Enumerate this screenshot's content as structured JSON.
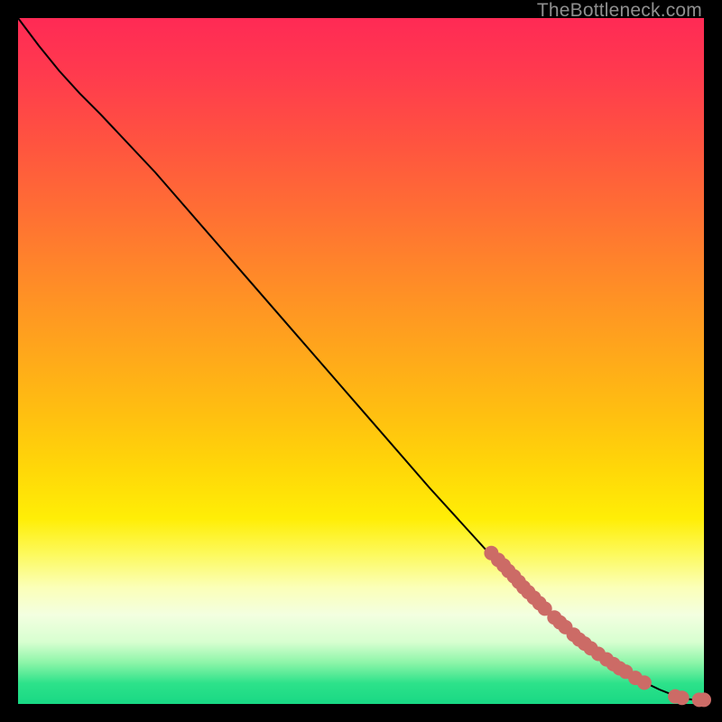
{
  "watermark": "TheBottleneck.com",
  "colors": {
    "dot": "#cc6b66",
    "curve": "#000000"
  },
  "chart_data": {
    "type": "line",
    "title": "",
    "xlabel": "",
    "ylabel": "",
    "xlim": [
      0,
      100
    ],
    "ylim": [
      0,
      100
    ],
    "grid": false,
    "legend": null,
    "background_gradient": {
      "direction": "vertical",
      "stops": [
        {
          "pos": 0.0,
          "color": "#ff2a55"
        },
        {
          "pos": 0.5,
          "color": "#ffc010"
        },
        {
          "pos": 0.75,
          "color": "#fdf95a"
        },
        {
          "pos": 0.9,
          "color": "#d7ffd0"
        },
        {
          "pos": 1.0,
          "color": "#18d884"
        }
      ]
    },
    "series": [
      {
        "name": "curve",
        "kind": "line",
        "x": [
          0,
          3,
          6,
          9,
          12,
          20,
          30,
          40,
          50,
          60,
          70,
          75,
          80,
          84,
          88,
          91,
          93.5,
          95.5,
          97,
          98.5,
          100
        ],
        "y": [
          100,
          96,
          92.3,
          89,
          86,
          77.5,
          66,
          54.5,
          43,
          31.5,
          20.5,
          15.5,
          11,
          8,
          5.3,
          3.3,
          2.1,
          1.3,
          0.8,
          0.6,
          0.6
        ]
      },
      {
        "name": "dots",
        "kind": "scatter",
        "points": [
          {
            "x": 69.0,
            "y": 22.0
          },
          {
            "x": 70.0,
            "y": 21.0
          },
          {
            "x": 70.8,
            "y": 20.2
          },
          {
            "x": 71.5,
            "y": 19.4
          },
          {
            "x": 72.3,
            "y": 18.6
          },
          {
            "x": 73.0,
            "y": 17.8
          },
          {
            "x": 73.7,
            "y": 17.0
          },
          {
            "x": 74.4,
            "y": 16.3
          },
          {
            "x": 75.2,
            "y": 15.5
          },
          {
            "x": 76.0,
            "y": 14.7
          },
          {
            "x": 76.8,
            "y": 13.9
          },
          {
            "x": 78.2,
            "y": 12.6
          },
          {
            "x": 79.0,
            "y": 11.9
          },
          {
            "x": 79.8,
            "y": 11.2
          },
          {
            "x": 81.0,
            "y": 10.1
          },
          {
            "x": 81.8,
            "y": 9.4
          },
          {
            "x": 82.6,
            "y": 8.8
          },
          {
            "x": 83.5,
            "y": 8.1
          },
          {
            "x": 84.6,
            "y": 7.3
          },
          {
            "x": 85.8,
            "y": 6.5
          },
          {
            "x": 86.8,
            "y": 5.8
          },
          {
            "x": 87.7,
            "y": 5.2
          },
          {
            "x": 88.6,
            "y": 4.7
          },
          {
            "x": 90.0,
            "y": 3.8
          },
          {
            "x": 91.3,
            "y": 3.1
          },
          {
            "x": 95.8,
            "y": 1.1
          },
          {
            "x": 96.8,
            "y": 0.9
          },
          {
            "x": 99.3,
            "y": 0.6
          },
          {
            "x": 100.0,
            "y": 0.6
          }
        ]
      }
    ]
  }
}
